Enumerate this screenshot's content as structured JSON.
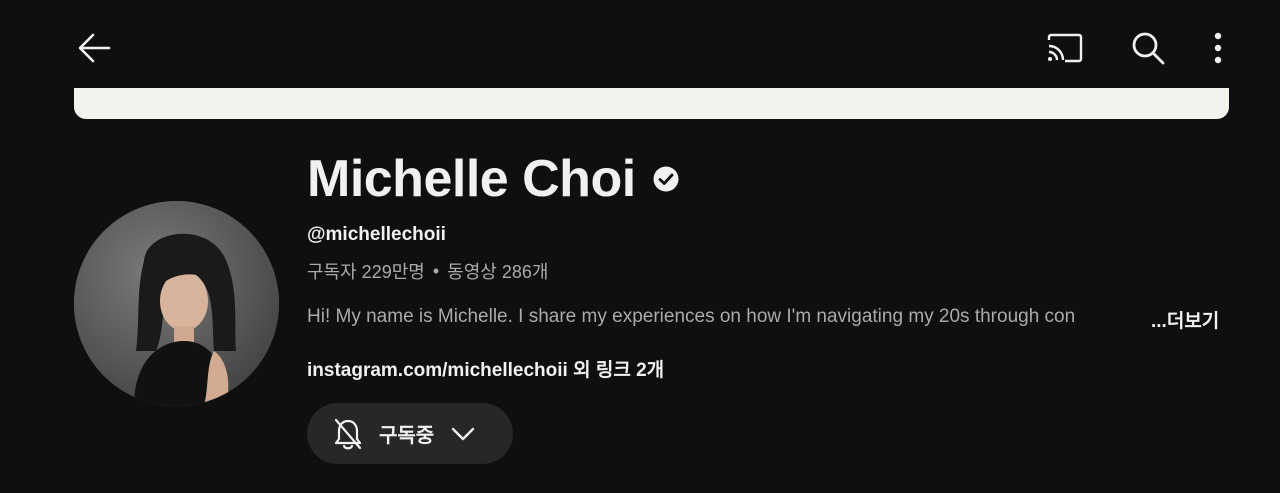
{
  "topbar": {
    "back_icon": "arrow-left-icon",
    "cast_icon": "cast-icon",
    "search_icon": "search-icon",
    "more_icon": "more-vertical-icon"
  },
  "channel": {
    "name": "Michelle Choi",
    "verified_icon": "verified-check-icon",
    "handle": "@michellechoii",
    "subscribers": "구독자 229만명",
    "separator": "•",
    "videos": "동영상 286개",
    "description": "Hi! My name is Michelle. I share my experiences on how I'm navigating my 20s through con",
    "more_label": "...더보기",
    "links": "instagram.com/michellechoii 외 링크 2개"
  },
  "subscribe": {
    "label": "구독중",
    "bell_icon": "bell-off-icon",
    "chevron_icon": "chevron-down-icon"
  },
  "colors": {
    "background": "#0f0f0f",
    "banner": "#f3f2ec",
    "text_primary": "#f1f1f1",
    "text_secondary": "#aaaaaa",
    "button_bg": "#272727"
  }
}
